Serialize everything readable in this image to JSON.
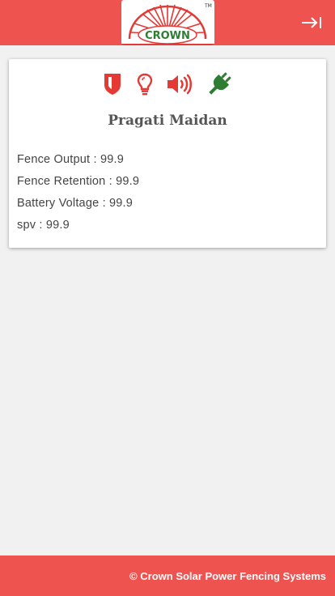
{
  "header": {
    "logo_text": "CROWN",
    "logo_tm": "TM",
    "menu_icon": "collapse-right-icon"
  },
  "card": {
    "status_icons": [
      {
        "name": "shield-icon",
        "color": "#e53935"
      },
      {
        "name": "lightbulb-icon",
        "color": "#e53935"
      },
      {
        "name": "speaker-icon",
        "color": "#e53935"
      },
      {
        "name": "power-plug-icon",
        "color": "#2e7d32"
      }
    ],
    "location": "Pragati Maidan",
    "readings": [
      {
        "label": "Fence Output : ",
        "value": "99.9"
      },
      {
        "label": "Fence Retention : ",
        "value": "99.9"
      },
      {
        "label": "Battery Voltage : ",
        "value": "99.9"
      },
      {
        "label": "spv : ",
        "value": "99.9"
      }
    ]
  },
  "footer": {
    "copyright": "© Crown Solar Power Fencing Systems"
  },
  "colors": {
    "brand": "#ef5350",
    "alert": "#e53935",
    "ok": "#2e7d32"
  }
}
